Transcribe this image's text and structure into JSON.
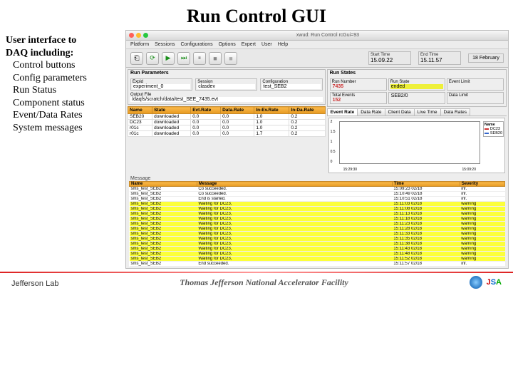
{
  "slide": {
    "title": "Run Control GUI",
    "side_header1": "User interface to",
    "side_header2": "DAQ including:",
    "side_items": [
      "Control buttons",
      "Config parameters",
      "Run Status",
      "Component status",
      "Event/Data Rates",
      "System messages"
    ]
  },
  "window": {
    "title": "xwud: Run Control rcGui=93"
  },
  "menu": [
    "Platform",
    "Sessions",
    "Configurations",
    "Options",
    "Expert",
    "User",
    "Help"
  ],
  "toolbar_icons": [
    "⎗",
    "⟳",
    "▶",
    "⏭",
    "⏸",
    "■",
    "■"
  ],
  "times": {
    "start_label": "Start Time",
    "start_val": "15.09.22",
    "end_label": "End Time",
    "end_val": "15.11.57",
    "date": "18 February"
  },
  "run_params": {
    "title": "Run Parameters",
    "expid_lbl": "Expid",
    "expid_val": "experiment_0",
    "session_lbl": "Session",
    "session_val": "clasdev",
    "config_lbl": "Configuration",
    "config_val": "test_SEB2",
    "output_lbl": "Output File",
    "output_val": "/daqfs/scratch/data/test_SEE_7435.evt"
  },
  "run_states": {
    "title": "Run States",
    "run_number_lbl": "Run Number",
    "run_number_val": "7435",
    "run_state_lbl": "Run State",
    "run_state_val": "ended",
    "event_limit_lbl": "Event Limit",
    "event_limit_val": "",
    "total_events_lbl": "Total Events",
    "total_events_val": "152",
    "component_lbl": "",
    "component_val": "SEB2/0",
    "data_limit_lbl": "Data Limit",
    "data_limit_val": ""
  },
  "components": {
    "headers": [
      "Name",
      "State",
      "Evt.Rate",
      "Data.Rate",
      "In-Ev.Rate",
      "In-Da.Rate"
    ],
    "rows": [
      [
        "SEB20",
        "downloaded",
        "0.0",
        "0.0",
        "1.0",
        "0.2"
      ],
      [
        "DC23",
        "downloaded",
        "0.0",
        "0.0",
        "1.0",
        "0.2"
      ],
      [
        "r01c",
        "downloaded",
        "0.0",
        "0.0",
        "1.0",
        "0.2"
      ],
      [
        "r01c",
        "downloaded",
        "0.0",
        "0.0",
        "1.7",
        "0.2"
      ]
    ]
  },
  "rate_tabs": [
    "Event Rate",
    "Data Rate",
    "Client Data",
    "Live Time",
    "Data Rates"
  ],
  "chart_data": {
    "type": "line",
    "title": "",
    "xlabel": "",
    "ylabel": "",
    "ylim": [
      0.0,
      2.0
    ],
    "yticks": [
      0.0,
      0.5,
      1.0,
      1.5,
      2.0
    ],
    "x_ticks": [
      "15:29:30",
      "15:09:20"
    ],
    "legend_header": "Name",
    "series": [
      {
        "name": "DC23",
        "color": "#cc3333",
        "values": []
      },
      {
        "name": "SEB20",
        "color": "#3366cc",
        "values": []
      }
    ]
  },
  "messages": {
    "title": "Message",
    "headers": [
      "Name",
      "Message",
      "Time",
      "Severity"
    ],
    "rows": [
      {
        "name": "sms_test_SEB2",
        "msg": "Co succeeded.",
        "time": "15:09:23 02/18",
        "sev": "inf."
      },
      {
        "name": "sms_test_SEB2",
        "msg": "Co succeeded.",
        "time": "15:10:49 02/18",
        "sev": "inf."
      },
      {
        "name": "sms_test_SEB2",
        "msg": "End is started.",
        "time": "15:10:51 02/18",
        "sev": "inf."
      },
      {
        "name": "sms_test_SEB2",
        "msg": "Waiting for DC23,",
        "time": "15:11:03 02/18",
        "sev": "warning"
      },
      {
        "name": "sms_test_SEB2",
        "msg": "Waiting for DC23,",
        "time": "15:11:08 02/18",
        "sev": "warning"
      },
      {
        "name": "sms_test_SEB2",
        "msg": "Waiting for DC23,",
        "time": "15:11:13 02/18",
        "sev": "warning"
      },
      {
        "name": "sms_test_SEB2",
        "msg": "Waiting for DC23,",
        "time": "15:11:18 02/18",
        "sev": "warning"
      },
      {
        "name": "sms_test_SEB2",
        "msg": "Waiting for DC23,",
        "time": "15:11:23 02/18",
        "sev": "warning"
      },
      {
        "name": "sms_test_SEB2",
        "msg": "Waiting for DC23,",
        "time": "15:11:28 02/18",
        "sev": "warning"
      },
      {
        "name": "sms_test_SEB2",
        "msg": "Waiting for DC23,",
        "time": "15:11:33 02/18",
        "sev": "warning"
      },
      {
        "name": "sms_test_SEB2",
        "msg": "Waiting for DC23,",
        "time": "15:11:35 02/18",
        "sev": "warning"
      },
      {
        "name": "sms_test_SEB2",
        "msg": "Waiting for DC23,",
        "time": "15:11:38 02/18",
        "sev": "warning"
      },
      {
        "name": "sms_test_SEB2",
        "msg": "Waiting for DC23,",
        "time": "15:11:43 02/18",
        "sev": "warning"
      },
      {
        "name": "sms_test_SEB2",
        "msg": "Waiting for DC23,",
        "time": "15:11:48 02/18",
        "sev": "warning"
      },
      {
        "name": "sms_test_SEB2",
        "msg": "Waiting for DC23,",
        "time": "15:11:52 02/18",
        "sev": "warning"
      },
      {
        "name": "sms_test_SEB2",
        "msg": "End succeeded.",
        "time": "15:11:57 02/18",
        "sev": "inf."
      }
    ]
  },
  "footer": {
    "jlab": "Jefferson Lab",
    "center": "Thomas Jefferson National Accelerator Facility",
    "jsa": "JSA"
  }
}
